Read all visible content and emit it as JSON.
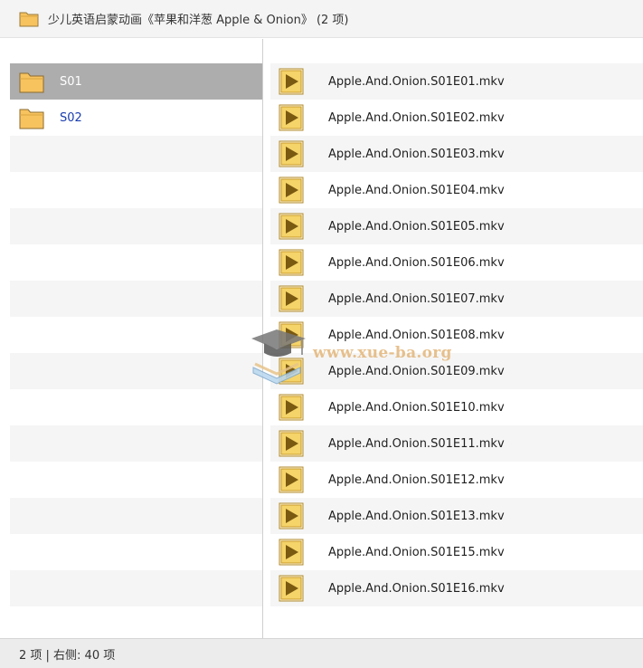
{
  "window": {
    "title": "少儿英语启蒙动画《苹果和洋葱 Apple & Onion》 (2 项)"
  },
  "left_pane": {
    "folders": [
      {
        "label": "S01",
        "selected": true
      },
      {
        "label": "S02",
        "selected": false
      }
    ]
  },
  "right_pane": {
    "files": [
      {
        "name": "Apple.And.Onion.S01E01.mkv"
      },
      {
        "name": "Apple.And.Onion.S01E02.mkv"
      },
      {
        "name": "Apple.And.Onion.S01E03.mkv"
      },
      {
        "name": "Apple.And.Onion.S01E04.mkv"
      },
      {
        "name": "Apple.And.Onion.S01E05.mkv"
      },
      {
        "name": "Apple.And.Onion.S01E06.mkv"
      },
      {
        "name": "Apple.And.Onion.S01E07.mkv"
      },
      {
        "name": "Apple.And.Onion.S01E08.mkv"
      },
      {
        "name": "Apple.And.Onion.S01E09.mkv"
      },
      {
        "name": "Apple.And.Onion.S01E10.mkv"
      },
      {
        "name": "Apple.And.Onion.S01E11.mkv"
      },
      {
        "name": "Apple.And.Onion.S01E12.mkv"
      },
      {
        "name": "Apple.And.Onion.S01E13.mkv"
      },
      {
        "name": "Apple.And.Onion.S01E15.mkv"
      },
      {
        "name": "Apple.And.Onion.S01E16.mkv"
      }
    ]
  },
  "status_bar": {
    "text": "2 项 | 右侧: 40 项"
  },
  "watermark": {
    "text": "www.xue-ba.org"
  },
  "colors": {
    "selected_row": "#adadad",
    "folder_label_link": "#1a3db0",
    "alt_row": "#f5f5f5",
    "folder_fill": "#f7c35f",
    "video_icon_fill": "#f5d46a"
  }
}
